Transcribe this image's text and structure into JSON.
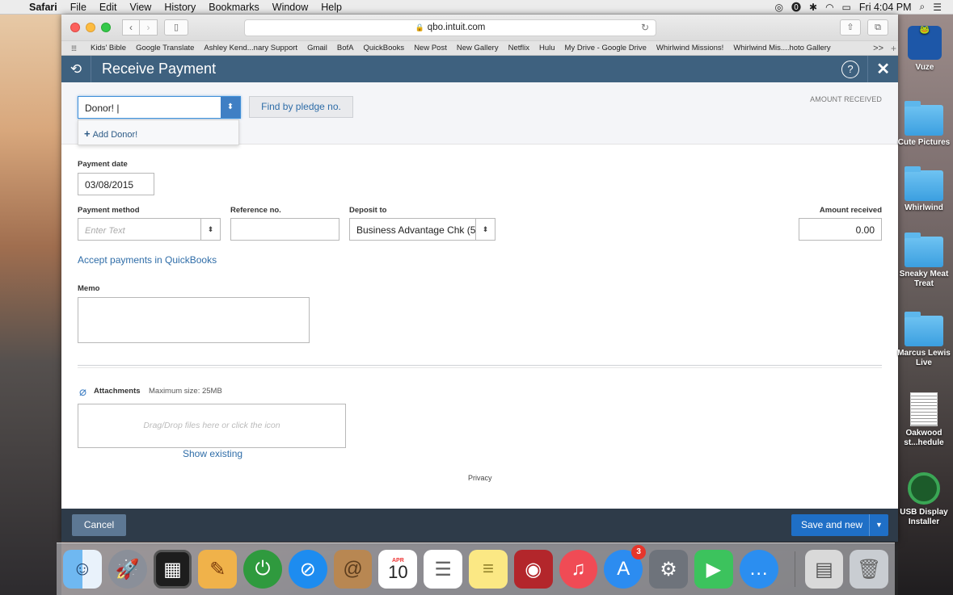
{
  "menubar": {
    "app": "Safari",
    "menus": [
      "File",
      "Edit",
      "View",
      "History",
      "Bookmarks",
      "Window",
      "Help"
    ],
    "clock": "Fri 4:04 PM"
  },
  "browser": {
    "url": "qbo.intuit.com",
    "bookmarks": [
      "Kids' Bible",
      "Google Translate",
      "Ashley Kend...nary Support",
      "Gmail",
      "BofA",
      "QuickBooks",
      "New Post",
      "New Gallery",
      "Netflix",
      "Hulu",
      "My Drive - Google Drive",
      "Whirlwind Missions!",
      "Whirlwind Mis....hoto Gallery"
    ],
    "more": ">>"
  },
  "header": {
    "title": "Receive Payment",
    "help": "?",
    "close": "✕"
  },
  "customer": {
    "value": "Donor! |",
    "add_option": "Add Donor!",
    "pledge_button": "Find by pledge no.",
    "amount_received_label": "AMOUNT RECEIVED"
  },
  "form": {
    "payment_date_label": "Payment date",
    "payment_date": "03/08/2015",
    "payment_method_label": "Payment method",
    "payment_method_placeholder": "Enter Text",
    "reference_label": "Reference no.",
    "deposit_label": "Deposit to",
    "deposit_value": "Business Advantage Chk (5",
    "amount_label": "Amount received",
    "amount_value": "0.00",
    "accept_link": "Accept payments in QuickBooks",
    "memo_label": "Memo"
  },
  "attachments": {
    "label": "Attachments",
    "max_size": "Maximum size: 25MB",
    "drop_text": "Drag/Drop files here or click the icon",
    "show_existing": "Show existing"
  },
  "privacy": "Privacy",
  "footer": {
    "cancel": "Cancel",
    "save": "Save and new"
  },
  "desktop": {
    "icons": [
      "Vuze",
      "Cute Pictures",
      "Whirlwind",
      "Sneaky Meat Treat",
      "Marcus Lewis Live",
      "Oakwood st...hedule",
      "USB Display Installer"
    ]
  },
  "dock": {
    "calendar_month": "APR",
    "calendar_day": "10",
    "appstore_badge": "3"
  }
}
